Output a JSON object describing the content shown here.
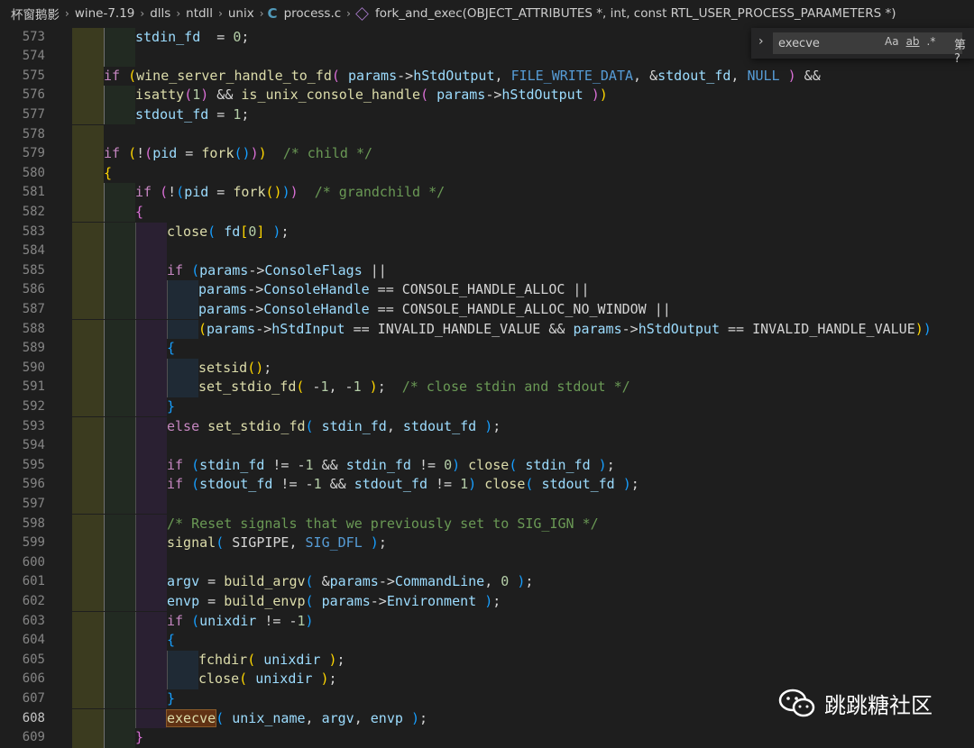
{
  "breadcrumb": {
    "items": [
      "杯窗鹅影",
      "wine-7.19",
      "dlls",
      "ntdll",
      "unix",
      "process.c"
    ],
    "c_icon": "C",
    "symbol": "fork_and_exec(OBJECT_ATTRIBUTES *, int, const RTL_USER_PROCESS_PARAMETERS *)"
  },
  "find": {
    "query": "execve",
    "match_case": "Aa",
    "whole_word": "ab",
    "regex": ".*",
    "count": "第 ?"
  },
  "active_line": "608",
  "lines": [
    {
      "n": "573",
      "indent": 1,
      "segs": [
        [
          "var",
          "stdin_fd"
        ],
        [
          "",
          "  = "
        ],
        [
          "num",
          "0"
        ],
        [
          "",
          ";"
        ]
      ]
    },
    {
      "n": "574",
      "indent": 0,
      "segs": []
    },
    {
      "n": "575",
      "indent": 0,
      "segs": [
        [
          "kw",
          "if"
        ],
        [
          "",
          " "
        ],
        [
          "b1",
          "("
        ],
        [
          "fn",
          "wine_server_handle_to_fd"
        ],
        [
          "b2",
          "("
        ],
        [
          "",
          " "
        ],
        [
          "var",
          "params"
        ],
        [
          "",
          "->"
        ],
        [
          "var",
          "hStdOutput"
        ],
        [
          "",
          ", "
        ],
        [
          "mac",
          "FILE_WRITE_DATA"
        ],
        [
          "",
          ", &"
        ],
        [
          "var",
          "stdout_fd"
        ],
        [
          "",
          ", "
        ],
        [
          "mac",
          "NULL"
        ],
        [
          "",
          " "
        ],
        [
          "b2",
          ")"
        ],
        [
          "",
          " &&"
        ]
      ]
    },
    {
      "n": "576",
      "indent": 1,
      "segs": [
        [
          "fn",
          "isatty"
        ],
        [
          "b2",
          "("
        ],
        [
          "num",
          "1"
        ],
        [
          "b2",
          ")"
        ],
        [
          "",
          " && "
        ],
        [
          "fn",
          "is_unix_console_handle"
        ],
        [
          "b2",
          "("
        ],
        [
          "",
          " "
        ],
        [
          "var",
          "params"
        ],
        [
          "",
          "->"
        ],
        [
          "var",
          "hStdOutput"
        ],
        [
          "",
          " "
        ],
        [
          "b2",
          ")"
        ],
        [
          "b1",
          ")"
        ]
      ]
    },
    {
      "n": "577",
      "indent": 1,
      "segs": [
        [
          "var",
          "stdout_fd"
        ],
        [
          "",
          " = "
        ],
        [
          "num",
          "1"
        ],
        [
          "",
          ";"
        ]
      ]
    },
    {
      "n": "578",
      "indent": 0,
      "segs": []
    },
    {
      "n": "579",
      "indent": 0,
      "segs": [
        [
          "kw",
          "if"
        ],
        [
          "",
          " "
        ],
        [
          "b1",
          "("
        ],
        [
          "",
          "!"
        ],
        [
          "b2",
          "("
        ],
        [
          "var",
          "pid"
        ],
        [
          "",
          " = "
        ],
        [
          "fn",
          "fork"
        ],
        [
          "b3",
          "()"
        ],
        [
          "b2",
          ")"
        ],
        [
          "b1",
          ")"
        ],
        [
          "",
          "  "
        ],
        [
          "cmt",
          "/* child */"
        ]
      ]
    },
    {
      "n": "580",
      "indent": 0,
      "segs": [
        [
          "b1",
          "{"
        ]
      ]
    },
    {
      "n": "581",
      "indent": 1,
      "segs": [
        [
          "kw",
          "if"
        ],
        [
          "",
          " "
        ],
        [
          "b2",
          "("
        ],
        [
          "",
          "!"
        ],
        [
          "b3",
          "("
        ],
        [
          "var",
          "pid"
        ],
        [
          "",
          " = "
        ],
        [
          "fn",
          "fork"
        ],
        [
          "b1",
          "()"
        ],
        [
          "b3",
          ")"
        ],
        [
          "b2",
          ")"
        ],
        [
          "",
          "  "
        ],
        [
          "cmt",
          "/* grandchild */"
        ]
      ]
    },
    {
      "n": "582",
      "indent": 1,
      "segs": [
        [
          "b2",
          "{"
        ]
      ]
    },
    {
      "n": "583",
      "indent": 2,
      "segs": [
        [
          "fn",
          "close"
        ],
        [
          "b3",
          "("
        ],
        [
          "",
          " "
        ],
        [
          "var",
          "fd"
        ],
        [
          "b1",
          "["
        ],
        [
          "num",
          "0"
        ],
        [
          "b1",
          "]"
        ],
        [
          "",
          " "
        ],
        [
          "b3",
          ")"
        ],
        [
          "",
          ";"
        ]
      ]
    },
    {
      "n": "584",
      "indent": 0,
      "segs": []
    },
    {
      "n": "585",
      "indent": 2,
      "segs": [
        [
          "kw",
          "if"
        ],
        [
          "",
          " "
        ],
        [
          "b3",
          "("
        ],
        [
          "var",
          "params"
        ],
        [
          "",
          "->"
        ],
        [
          "var",
          "ConsoleFlags"
        ],
        [
          "",
          " ||"
        ]
      ]
    },
    {
      "n": "586",
      "indent": 3,
      "segs": [
        [
          "var",
          "params"
        ],
        [
          "",
          "->"
        ],
        [
          "var",
          "ConsoleHandle"
        ],
        [
          "",
          " == CONSOLE_HANDLE_ALLOC ||"
        ]
      ]
    },
    {
      "n": "587",
      "indent": 3,
      "segs": [
        [
          "var",
          "params"
        ],
        [
          "",
          "->"
        ],
        [
          "var",
          "ConsoleHandle"
        ],
        [
          "",
          " == CONSOLE_HANDLE_ALLOC_NO_WINDOW ||"
        ]
      ]
    },
    {
      "n": "588",
      "indent": 3,
      "segs": [
        [
          "b1",
          "("
        ],
        [
          "var",
          "params"
        ],
        [
          "",
          "->"
        ],
        [
          "var",
          "hStdInput"
        ],
        [
          "",
          " == INVALID_HANDLE_VALUE && "
        ],
        [
          "var",
          "params"
        ],
        [
          "",
          "->"
        ],
        [
          "var",
          "hStdOutput"
        ],
        [
          "",
          " == INVALID_HANDLE_VALUE"
        ],
        [
          "b1",
          ")"
        ],
        [
          "b3",
          ")"
        ]
      ]
    },
    {
      "n": "589",
      "indent": 2,
      "segs": [
        [
          "b3",
          "{"
        ]
      ]
    },
    {
      "n": "590",
      "indent": 3,
      "segs": [
        [
          "fn",
          "setsid"
        ],
        [
          "b1",
          "()"
        ],
        [
          "",
          ";"
        ]
      ]
    },
    {
      "n": "591",
      "indent": 3,
      "segs": [
        [
          "fn",
          "set_stdio_fd"
        ],
        [
          "b1",
          "("
        ],
        [
          "",
          " -"
        ],
        [
          "num",
          "1"
        ],
        [
          "",
          ", -"
        ],
        [
          "num",
          "1"
        ],
        [
          "",
          " "
        ],
        [
          "b1",
          ")"
        ],
        [
          "",
          ";  "
        ],
        [
          "cmt",
          "/* close stdin and stdout */"
        ]
      ]
    },
    {
      "n": "592",
      "indent": 2,
      "segs": [
        [
          "b3",
          "}"
        ]
      ]
    },
    {
      "n": "593",
      "indent": 2,
      "segs": [
        [
          "kw",
          "else"
        ],
        [
          "",
          " "
        ],
        [
          "fn",
          "set_stdio_fd"
        ],
        [
          "b3",
          "("
        ],
        [
          "",
          " "
        ],
        [
          "var",
          "stdin_fd"
        ],
        [
          "",
          ", "
        ],
        [
          "var",
          "stdout_fd"
        ],
        [
          "",
          " "
        ],
        [
          "b3",
          ")"
        ],
        [
          "",
          ";"
        ]
      ]
    },
    {
      "n": "594",
      "indent": 0,
      "segs": []
    },
    {
      "n": "595",
      "indent": 2,
      "segs": [
        [
          "kw",
          "if"
        ],
        [
          "",
          " "
        ],
        [
          "b3",
          "("
        ],
        [
          "var",
          "stdin_fd"
        ],
        [
          "",
          " != -"
        ],
        [
          "num",
          "1"
        ],
        [
          "",
          " && "
        ],
        [
          "var",
          "stdin_fd"
        ],
        [
          "",
          " != "
        ],
        [
          "num",
          "0"
        ],
        [
          "b3",
          ")"
        ],
        [
          "",
          " "
        ],
        [
          "fn",
          "close"
        ],
        [
          "b3",
          "("
        ],
        [
          "",
          " "
        ],
        [
          "var",
          "stdin_fd"
        ],
        [
          "",
          " "
        ],
        [
          "b3",
          ")"
        ],
        [
          "",
          ";"
        ]
      ]
    },
    {
      "n": "596",
      "indent": 2,
      "segs": [
        [
          "kw",
          "if"
        ],
        [
          "",
          " "
        ],
        [
          "b3",
          "("
        ],
        [
          "var",
          "stdout_fd"
        ],
        [
          "",
          " != -"
        ],
        [
          "num",
          "1"
        ],
        [
          "",
          " && "
        ],
        [
          "var",
          "stdout_fd"
        ],
        [
          "",
          " != "
        ],
        [
          "num",
          "1"
        ],
        [
          "b3",
          ")"
        ],
        [
          "",
          " "
        ],
        [
          "fn",
          "close"
        ],
        [
          "b3",
          "("
        ],
        [
          "",
          " "
        ],
        [
          "var",
          "stdout_fd"
        ],
        [
          "",
          " "
        ],
        [
          "b3",
          ")"
        ],
        [
          "",
          ";"
        ]
      ]
    },
    {
      "n": "597",
      "indent": 0,
      "segs": []
    },
    {
      "n": "598",
      "indent": 2,
      "segs": [
        [
          "cmt",
          "/* Reset signals that we previously set to SIG_IGN */"
        ]
      ]
    },
    {
      "n": "599",
      "indent": 2,
      "segs": [
        [
          "fn",
          "signal"
        ],
        [
          "b3",
          "("
        ],
        [
          "",
          " SIGPIPE, "
        ],
        [
          "mac",
          "SIG_DFL"
        ],
        [
          "",
          " "
        ],
        [
          "b3",
          ")"
        ],
        [
          "",
          ";"
        ]
      ]
    },
    {
      "n": "600",
      "indent": 0,
      "segs": []
    },
    {
      "n": "601",
      "indent": 2,
      "segs": [
        [
          "var",
          "argv"
        ],
        [
          "",
          " = "
        ],
        [
          "fn",
          "build_argv"
        ],
        [
          "b3",
          "("
        ],
        [
          "",
          " &"
        ],
        [
          "var",
          "params"
        ],
        [
          "",
          "->"
        ],
        [
          "var",
          "CommandLine"
        ],
        [
          "",
          ", "
        ],
        [
          "num",
          "0"
        ],
        [
          "",
          " "
        ],
        [
          "b3",
          ")"
        ],
        [
          "",
          ";"
        ]
      ]
    },
    {
      "n": "602",
      "indent": 2,
      "segs": [
        [
          "var",
          "envp"
        ],
        [
          "",
          " = "
        ],
        [
          "fn",
          "build_envp"
        ],
        [
          "b3",
          "("
        ],
        [
          "",
          " "
        ],
        [
          "var",
          "params"
        ],
        [
          "",
          "->"
        ],
        [
          "var",
          "Environment"
        ],
        [
          "",
          " "
        ],
        [
          "b3",
          ")"
        ],
        [
          "",
          ";"
        ]
      ]
    },
    {
      "n": "603",
      "indent": 2,
      "segs": [
        [
          "kw",
          "if"
        ],
        [
          "",
          " "
        ],
        [
          "b3",
          "("
        ],
        [
          "var",
          "unixdir"
        ],
        [
          "",
          " != -"
        ],
        [
          "num",
          "1"
        ],
        [
          "b3",
          ")"
        ]
      ]
    },
    {
      "n": "604",
      "indent": 2,
      "segs": [
        [
          "b3",
          "{"
        ]
      ]
    },
    {
      "n": "605",
      "indent": 3,
      "segs": [
        [
          "fn",
          "fchdir"
        ],
        [
          "b1",
          "("
        ],
        [
          "",
          " "
        ],
        [
          "var",
          "unixdir"
        ],
        [
          "",
          " "
        ],
        [
          "b1",
          ")"
        ],
        [
          "",
          ";"
        ]
      ]
    },
    {
      "n": "606",
      "indent": 3,
      "segs": [
        [
          "fn",
          "close"
        ],
        [
          "b1",
          "("
        ],
        [
          "",
          " "
        ],
        [
          "var",
          "unixdir"
        ],
        [
          "",
          " "
        ],
        [
          "b1",
          ")"
        ],
        [
          "",
          ";"
        ]
      ]
    },
    {
      "n": "607",
      "indent": 2,
      "segs": [
        [
          "b3",
          "}"
        ]
      ]
    },
    {
      "n": "608",
      "indent": 2,
      "segs": [
        [
          "fn hl",
          "execve"
        ],
        [
          "b3",
          "("
        ],
        [
          "",
          " "
        ],
        [
          "var",
          "unix_name"
        ],
        [
          "",
          ", "
        ],
        [
          "var",
          "argv"
        ],
        [
          "",
          ", "
        ],
        [
          "var",
          "envp"
        ],
        [
          "",
          " "
        ],
        [
          "b3",
          ")"
        ],
        [
          "",
          ";"
        ]
      ]
    },
    {
      "n": "609",
      "indent": 1,
      "segs": [
        [
          "b2",
          "}"
        ]
      ]
    }
  ],
  "guide_colors": {
    "level0": "#3b3b1f",
    "level1": "#222a22",
    "level2": "#2a2032",
    "level3": "#1f2a35"
  },
  "watermark": {
    "text": "跳跳糖社区",
    "icon": "wechat-icon"
  }
}
